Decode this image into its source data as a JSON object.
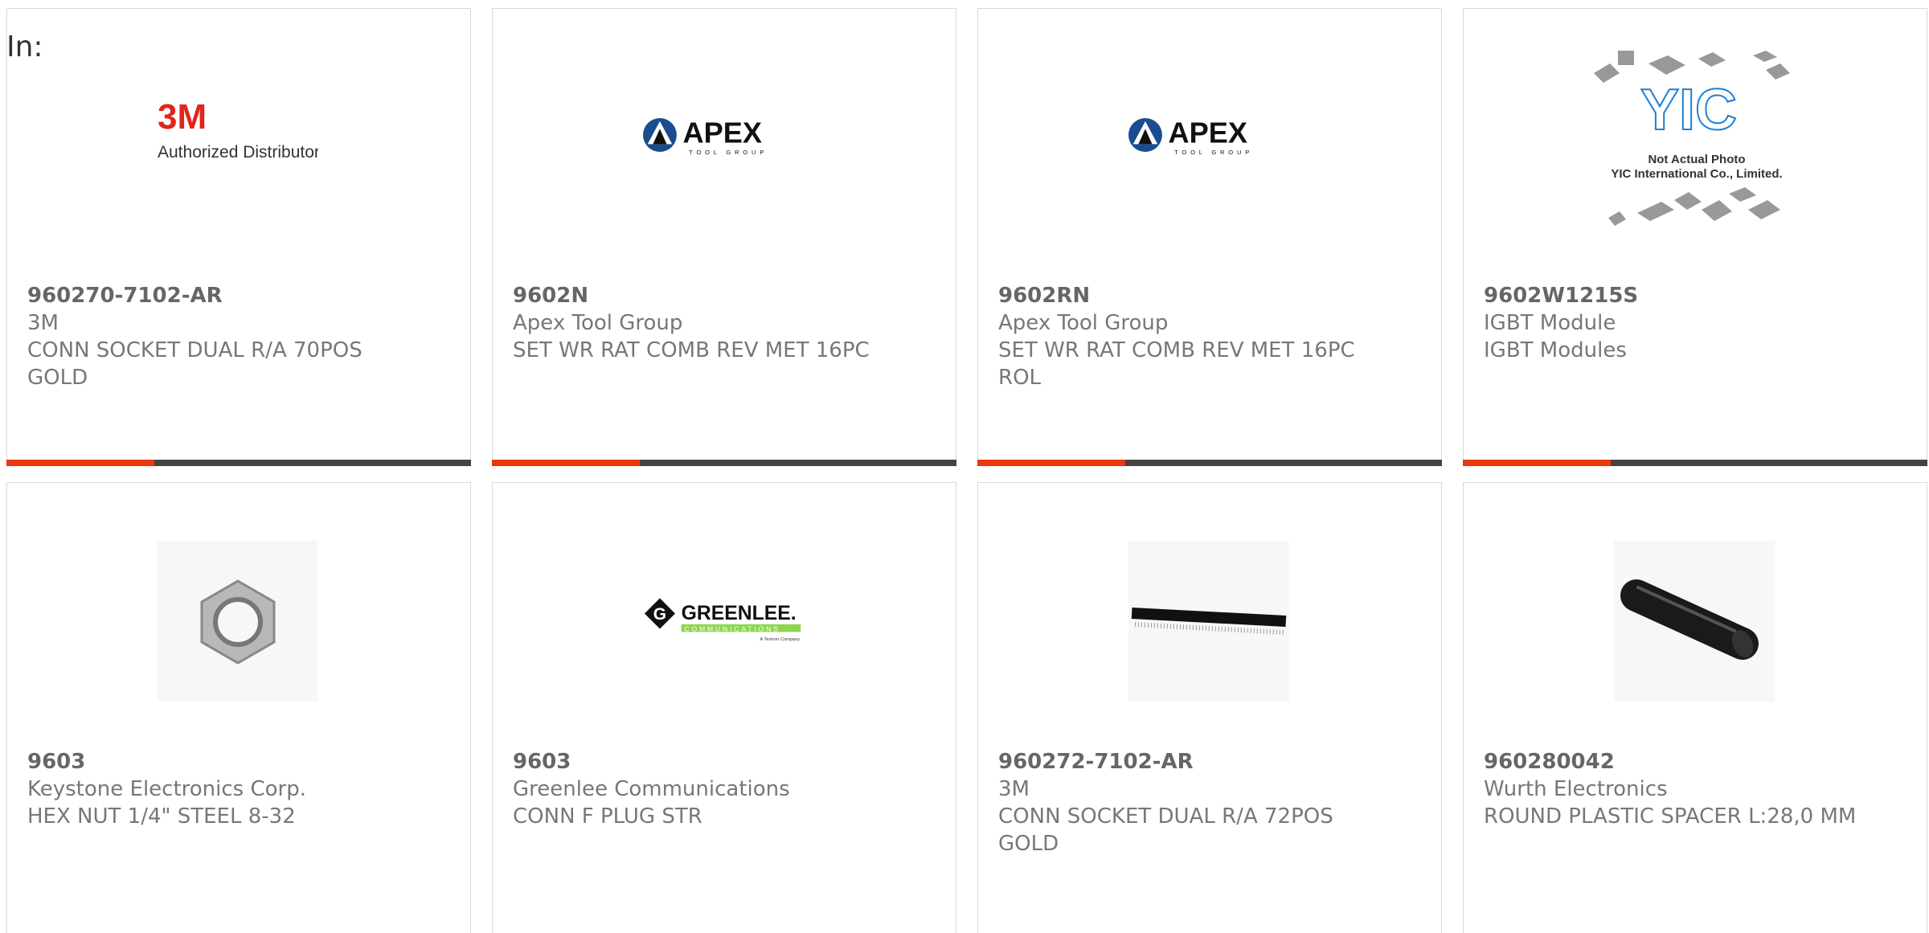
{
  "header": {
    "in_label": "In:"
  },
  "products": [
    {
      "part_number": "960270-7102-AR",
      "manufacturer": "3M",
      "description": "CONN SOCKET DUAL R/A 70POS GOLD",
      "image": "3m-logo",
      "image_text": "Authorized Distributor"
    },
    {
      "part_number": "9602N",
      "manufacturer": "Apex Tool Group",
      "description": "SET WR RAT COMB REV MET 16PC",
      "image": "apex-logo",
      "image_text": "APEX",
      "image_subtext": "TOOL GROUP"
    },
    {
      "part_number": "9602RN",
      "manufacturer": "Apex Tool Group",
      "description": "SET WR RAT COMB REV MET 16PC ROL",
      "image": "apex-logo",
      "image_text": "APEX",
      "image_subtext": "TOOL GROUP"
    },
    {
      "part_number": "9602W1215S",
      "manufacturer": "IGBT Module",
      "description": "IGBT Modules",
      "image": "yic-placeholder",
      "image_text": "Not Actual Photo",
      "image_subtext": "YIC International Co., Limited."
    },
    {
      "part_number": "9603",
      "manufacturer": "Keystone Electronics Corp.",
      "description": "HEX NUT 1/4\" STEEL 8-32",
      "image": "hex-nut-photo"
    },
    {
      "part_number": "9603",
      "manufacturer": "Greenlee Communications",
      "description": "CONN F PLUG STR",
      "image": "greenlee-logo",
      "image_text": "GREENLEE.",
      "image_subtext": "COMMUNICATIONS",
      "image_subtext2": "A Textron Company"
    },
    {
      "part_number": "960272-7102-AR",
      "manufacturer": "3M",
      "description": "CONN SOCKET DUAL R/A 72POS GOLD",
      "image": "pin-header-photo"
    },
    {
      "part_number": "960280042",
      "manufacturer": "Wurth Electronics",
      "description": "ROUND PLASTIC SPACER L:28,0 MM",
      "image": "spacer-photo"
    }
  ],
  "colors": {
    "accent": "#e8380d",
    "bar": "#444444",
    "border": "#d9d9d9",
    "text": "#666666"
  }
}
